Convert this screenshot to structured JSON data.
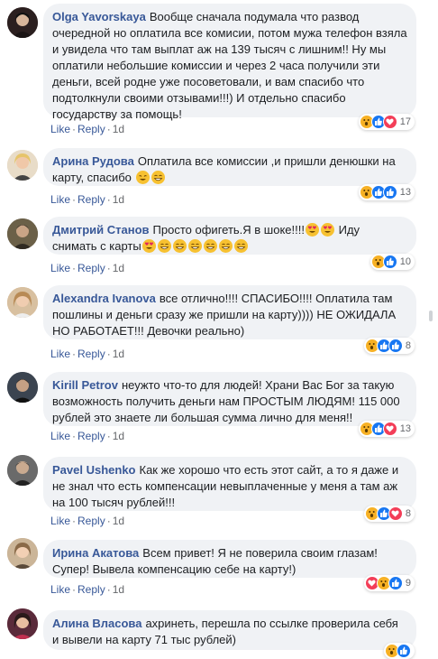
{
  "comments": [
    {
      "author": "Olga Yavorskaya",
      "text": "Вообще сначала подумала что развод очередной но оплатила все комисии, потом мужа телефон взяла и увидела что там выплат аж на 139 тысяч с лишним!! Ну мы оплатили небольшие комиссии и через 2 часа получили эти деньги, всей родне уже посоветовали, и вам спасибо что подтолкнули своими отзывами!!!) И отдельно спасибо государству за помощь!",
      "reactions": [
        "wow",
        "like",
        "love"
      ],
      "reaction_count": "17",
      "like": "Like",
      "reply": "Reply",
      "time": "1d",
      "avatar_color": "#3b2a2a"
    },
    {
      "author": "Арина Рудова",
      "text": "Оплатила все комиссии ,и пришли денюшки на карту, спасибо",
      "emojis": [
        "sweat",
        "grin"
      ],
      "reactions": [
        "wow",
        "like",
        "like"
      ],
      "reaction_count": "13",
      "like": "Like",
      "reply": "Reply",
      "time": "1d",
      "avatar_color": "#d9c7a8"
    },
    {
      "author": "Дмитрий Станов",
      "text": "Просто офигеть.Я в шоке!!!!",
      "text2": "Иду снимать с карты",
      "emojis_mid": [
        "heart-eyes",
        "heart-eyes"
      ],
      "emojis": [
        "heart-eyes",
        "grin",
        "grin",
        "grin",
        "grin",
        "grin",
        "grin"
      ],
      "reactions": [
        "wow",
        "like"
      ],
      "reaction_count": "10",
      "like": "Like",
      "reply": "Reply",
      "time": "1d",
      "avatar_color": "#5a5040"
    },
    {
      "author": "Alexandra Ivanova",
      "text": "все отлично!!!! СПАСИБО!!!! Оплатила там пошлины и деньги сразу же пришли на карту)))) НЕ ОЖИДАЛА НО РАБОТАЕТ!!! Девочки реально)",
      "reactions": [
        "wow",
        "like",
        "like"
      ],
      "reaction_count": "8",
      "like": "Like",
      "reply": "Reply",
      "time": "1d",
      "avatar_color": "#c8a27a"
    },
    {
      "author": "Kirill Petrov",
      "text": "неужто что-то для людей! Храни Вас Бог за такую возможность получить деньги нам ПРОСТЫМ ЛЮДЯМ! 115 000 рублей это знаете ли большая сумма лично для меня!!",
      "reactions": [
        "wow",
        "like",
        "love"
      ],
      "reaction_count": "13",
      "like": "Like",
      "reply": "Reply",
      "time": "1d",
      "avatar_color": "#2e3540"
    },
    {
      "author": "Pavel Ushenko",
      "text": "Как же хорошо что есть этот сайт, а то я даже и не знал что есть компенсации невыплаченные у меня а там аж на 100 тысяч рублей!!!",
      "reactions": [
        "wow",
        "like",
        "love"
      ],
      "reaction_count": "8",
      "like": "Like",
      "reply": "Reply",
      "time": "1d",
      "avatar_color": "#555555"
    },
    {
      "author": "Ирина Акатова",
      "text": "Всем привет! Я не поверила своим глазам! Супер! Вывела компенсацию себе на карту!)",
      "reactions": [
        "love",
        "wow",
        "like"
      ],
      "reaction_count": "9",
      "like": "Like",
      "reply": "Reply",
      "time": "1d",
      "avatar_color": "#b89a7a"
    },
    {
      "author": "Алина Власова",
      "text": "ахринеть, перешла по ссылке проверила себя и вывели на карту 71 тыс рублей)",
      "reactions": [
        "wow",
        "like"
      ],
      "reaction_count": "",
      "like": "Like",
      "reply": "Reply",
      "time": "1d",
      "avatar_color": "#7a3040"
    }
  ],
  "colors": {
    "name": "#385898",
    "bubble": "#f0f2f5",
    "meta": "#65676b"
  }
}
